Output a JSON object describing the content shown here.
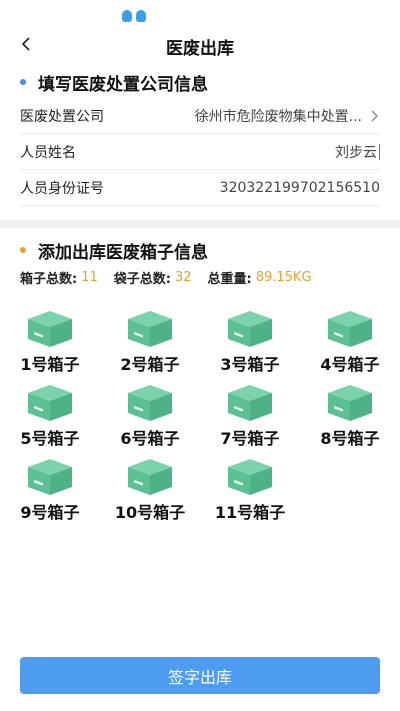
{
  "colors": {
    "accent": "#4d9cf0",
    "dot_blue": "#4a8fe0",
    "dot_orange": "#e8a033",
    "box_green": "#5cc095",
    "highlight": "#e8a033"
  },
  "status_icons": [
    "qq-icon",
    "qq-icon"
  ],
  "nav": {
    "title": "医废出库",
    "back_icon": "chevron-left-icon"
  },
  "company_section": {
    "title": "填写医废处置公司信息",
    "fields": [
      {
        "label": "医废处置公司",
        "value": "徐州市危险废物集中处置...",
        "has_chevron": true
      },
      {
        "label": "人员姓名",
        "value": "刘步云",
        "has_caret": true
      },
      {
        "label": "人员身份证号",
        "value": "320322199702156510"
      }
    ]
  },
  "box_section": {
    "title": "添加出库医废箱子信息",
    "summary": {
      "box_label": "箱子总数:",
      "box_value": "11",
      "bag_label": "袋子总数:",
      "bag_value": "32",
      "weight_label": "总重量:",
      "weight_value": "89.15KG"
    },
    "boxes": [
      "1号箱子",
      "2号箱子",
      "3号箱子",
      "4号箱子",
      "5号箱子",
      "6号箱子",
      "7号箱子",
      "8号箱子",
      "9号箱子",
      "10号箱子",
      "11号箱子"
    ]
  },
  "submit_label": "签字出库"
}
